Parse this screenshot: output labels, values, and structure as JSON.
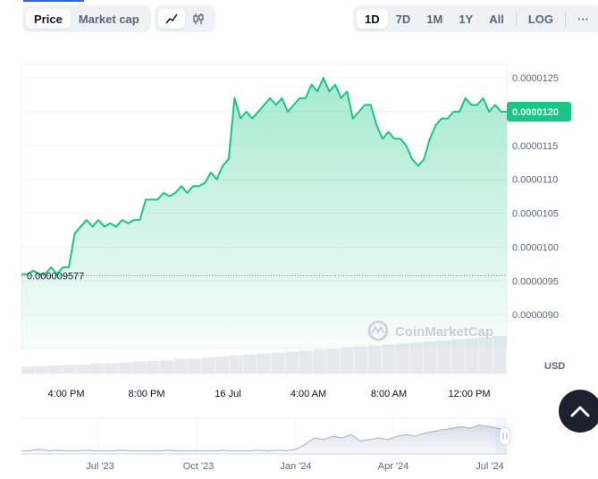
{
  "toolbar": {
    "view_tabs": [
      "Price",
      "Market cap"
    ],
    "active_view": "Price",
    "chart_modes": [
      "line-chart-icon",
      "candlestick-icon"
    ],
    "active_mode": "line-chart-icon",
    "ranges": [
      "1D",
      "7D",
      "1M",
      "1Y",
      "All"
    ],
    "active_range": "1D",
    "log_label": "LOG",
    "more_label": "···"
  },
  "chart_data": {
    "type": "area",
    "y_ticks": [
      "0.0000125",
      "0.0000120",
      "0.0000115",
      "0.0000110",
      "0.0000105",
      "0.0000100",
      "0.0000095",
      "0.0000090"
    ],
    "x_ticks": [
      "4:00 PM",
      "8:00 PM",
      "16 Jul",
      "4:00 AM",
      "8:00 AM",
      "12:00 PM"
    ],
    "currency": "USD",
    "current_price": "0.0000120",
    "open_price_label": "0.000009577",
    "open_price": 9.577e-06,
    "grid": true,
    "line_color": "#16c784",
    "series": [
      {
        "values": [
          9.6e-06,
          9.6e-06,
          9.65e-06,
          9.6e-06,
          9.6e-06,
          9.7e-06,
          9.6e-06,
          9.7e-06,
          9.7e-06,
          1.02e-05,
          1.03e-05,
          1.04e-05,
          1.03e-05,
          1.04e-05,
          1.03e-05,
          1.035e-05,
          1.03e-05,
          1.04e-05,
          1.035e-05,
          1.04e-05,
          1.04e-05,
          1.07e-05,
          1.07e-05,
          1.07e-05,
          1.08e-05,
          1.075e-05,
          1.08e-05,
          1.09e-05,
          1.08e-05,
          1.09e-05,
          1.09e-05,
          1.095e-05,
          1.11e-05,
          1.1e-05,
          1.12e-05,
          1.13e-05,
          1.22e-05,
          1.19e-05,
          1.2e-05,
          1.19e-05,
          1.2e-05,
          1.21e-05,
          1.22e-05,
          1.21e-05,
          1.22e-05,
          1.2e-05,
          1.21e-05,
          1.22e-05,
          1.22e-05,
          1.24e-05,
          1.23e-05,
          1.25e-05,
          1.23e-05,
          1.24e-05,
          1.22e-05,
          1.23e-05,
          1.19e-05,
          1.2e-05,
          1.21e-05,
          1.21e-05,
          1.18e-05,
          1.16e-05,
          1.17e-05,
          1.16e-05,
          1.16e-05,
          1.15e-05,
          1.13e-05,
          1.12e-05,
          1.13e-05,
          1.16e-05,
          1.18e-05,
          1.19e-05,
          1.19e-05,
          1.2e-05,
          1.2e-05,
          1.22e-05,
          1.21e-05,
          1.21e-05,
          1.22e-05,
          1.2e-05,
          1.21e-05,
          1.2e-05,
          1.2e-05
        ],
        "y_min": 8.5e-06,
        "y_max": 1.27e-05
      }
    ],
    "volume": {
      "values": [
        0.14,
        0.15,
        0.16,
        0.17,
        0.18,
        0.2,
        0.21,
        0.22,
        0.24,
        0.25,
        0.27,
        0.29,
        0.3,
        0.32,
        0.34,
        0.36,
        0.38,
        0.4,
        0.42,
        0.44,
        0.46,
        0.48,
        0.5,
        0.52,
        0.54,
        0.56,
        0.58,
        0.6,
        0.62,
        0.64,
        0.66,
        0.68,
        0.7,
        0.72,
        0.75
      ]
    },
    "navigator": {
      "x_ticks": [
        "Jul '23",
        "Oct '23",
        "Jan '24",
        "Apr '24",
        "Jul '24"
      ],
      "values": [
        0.1,
        0.1,
        0.15,
        0.1,
        0.12,
        0.1,
        0.1,
        0.12,
        0.1,
        0.1,
        0.1,
        0.12,
        0.1,
        0.1,
        0.1,
        0.1,
        0.12,
        0.1,
        0.1,
        0.1,
        0.1,
        0.1,
        0.12,
        0.1,
        0.1,
        0.1,
        0.12,
        0.1,
        0.12,
        0.1,
        0.15,
        0.3,
        0.5,
        0.45,
        0.55,
        0.5,
        0.6,
        0.4,
        0.45,
        0.5,
        0.45,
        0.55,
        0.6,
        0.55,
        0.65,
        0.7,
        0.75,
        0.8,
        0.85,
        0.8,
        0.9,
        0.85,
        0.8,
        0.75
      ]
    }
  },
  "watermark": "CoinMarketCap",
  "colors": {
    "accent": "#3861fb",
    "up": "#16c784",
    "scroll_button": "#1b222d"
  }
}
